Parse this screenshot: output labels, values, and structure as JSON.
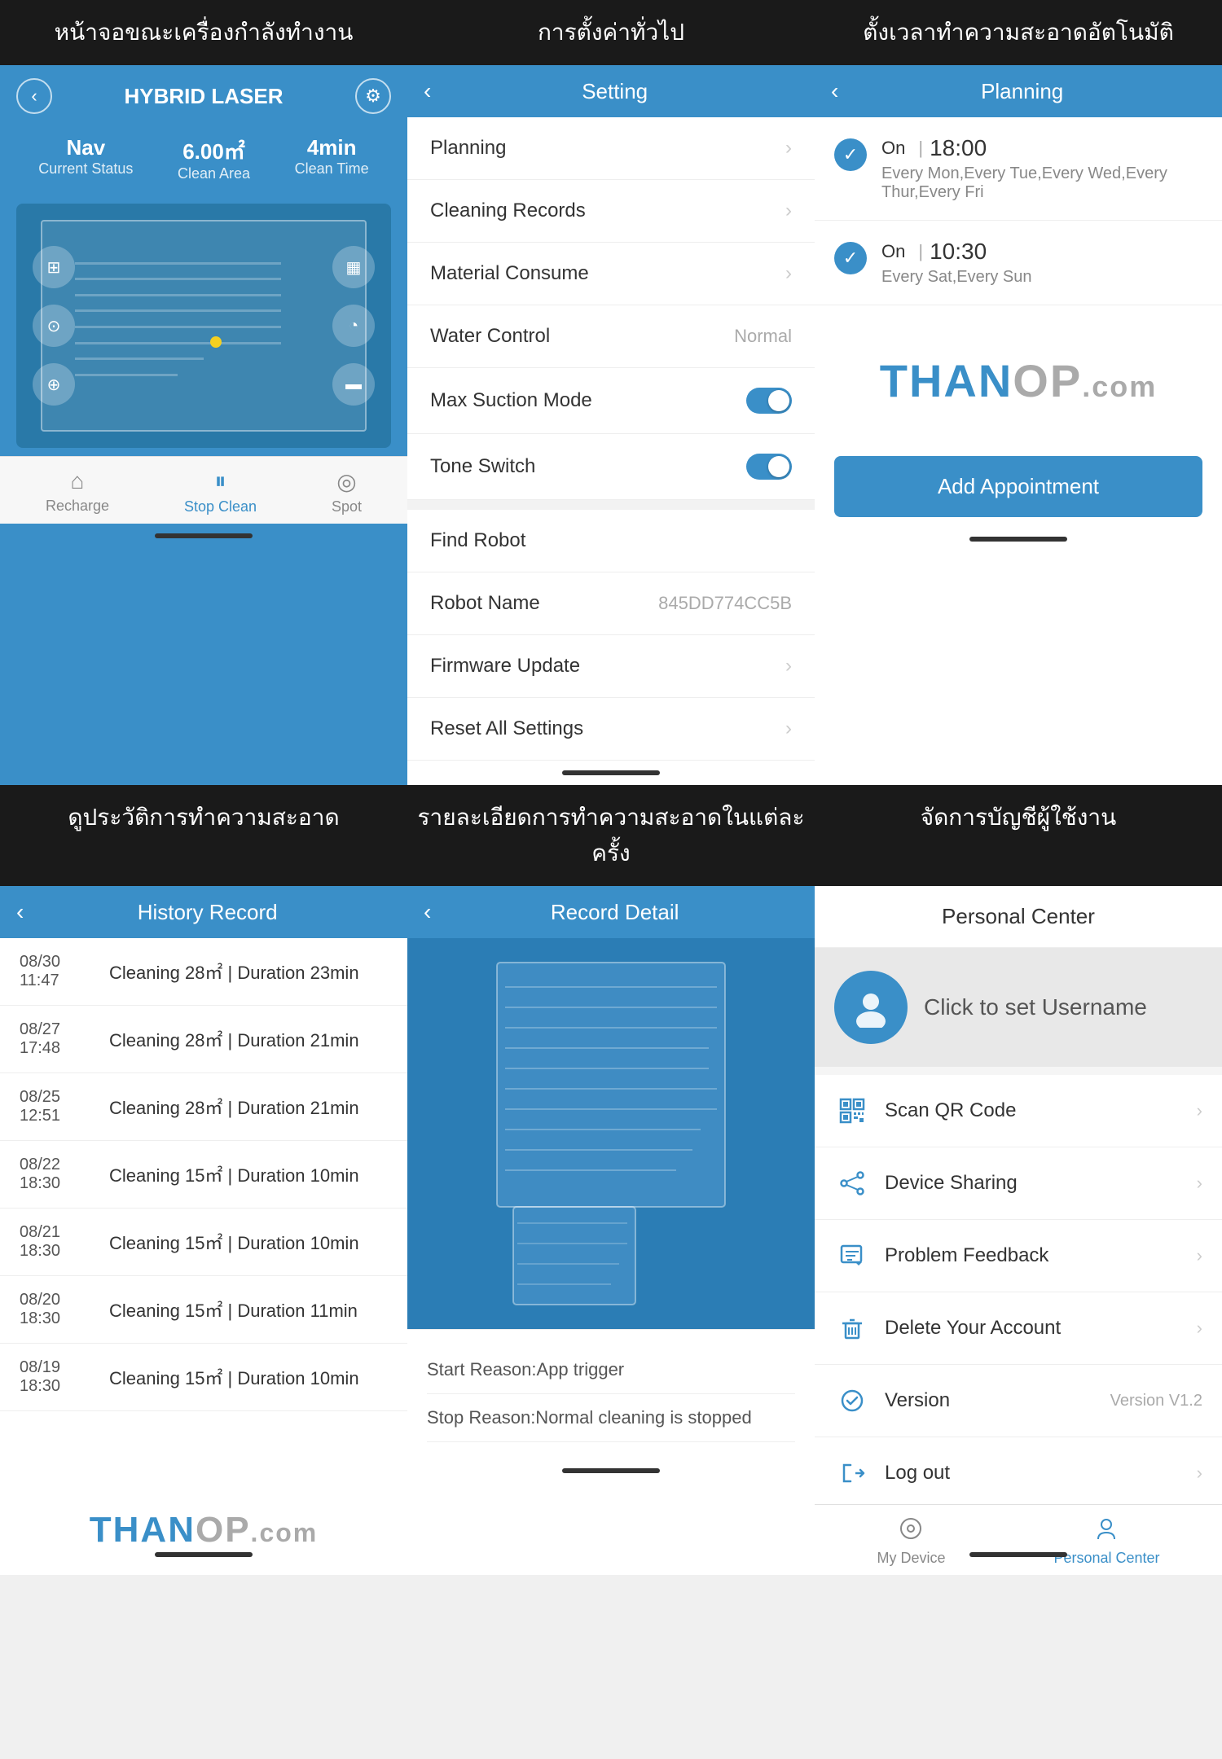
{
  "headers": {
    "col1_row1": "หน้าจอขณะเครื่องกำลังทำงาน",
    "col2_row1": "การตั้งค่าทั่วไป",
    "col3_row1": "ตั้งเวลาทำความสะอาดอัตโนมัติ",
    "col1_row2": "ดูประวัติการทำความสะอาด",
    "col2_row2": "รายละเอียดการทำความสะอาดในแต่ละครั้ง",
    "col3_row2": "จัดการบัญชีผู้ใช้งาน"
  },
  "panel1": {
    "title": "HYBRID LASER",
    "stats": [
      {
        "value": "Nav",
        "label": "Current Status"
      },
      {
        "value": "6.00㎡",
        "label": "Clean Area"
      },
      {
        "value": "4min",
        "label": "Clean Time"
      }
    ],
    "nav": [
      {
        "label": "Recharge",
        "active": false
      },
      {
        "label": "Stop Clean",
        "active": true
      },
      {
        "label": "Spot",
        "active": false
      }
    ]
  },
  "panel2": {
    "title": "Setting",
    "back_label": "‹",
    "items": [
      {
        "label": "Planning",
        "value": "",
        "type": "arrow"
      },
      {
        "label": "Cleaning Records",
        "value": "",
        "type": "arrow"
      },
      {
        "label": "Material Consume",
        "value": "",
        "type": "arrow"
      },
      {
        "label": "Water Control",
        "value": "Normal",
        "type": "value"
      },
      {
        "label": "Max Suction Mode",
        "value": "",
        "type": "toggle"
      },
      {
        "label": "Tone Switch",
        "value": "",
        "type": "toggle"
      },
      {
        "label": "Find Robot",
        "value": "",
        "type": "plain"
      },
      {
        "label": "Robot Name",
        "value": "845DD774CC5B",
        "type": "value"
      },
      {
        "label": "Firmware Update",
        "value": "",
        "type": "arrow"
      },
      {
        "label": "Reset All Settings",
        "value": "",
        "type": "arrow"
      }
    ]
  },
  "panel3": {
    "title": "Planning",
    "back_label": "‹",
    "schedules": [
      {
        "enabled": true,
        "status": "On",
        "time": "18:00",
        "days": "Every Mon,Every Tue,Every Wed,Every Thur,Every Fri"
      },
      {
        "enabled": true,
        "status": "On",
        "time": "10:30",
        "days": "Every Sat,Every Sun"
      }
    ],
    "add_button": "Add Appointment",
    "logo": "THANOP",
    "logo_ext": ".com"
  },
  "panel4": {
    "title": "History Record",
    "back_label": "‹",
    "records": [
      {
        "date": "08/30\n11:47",
        "desc": "Cleaning 28㎡ | Duration 23min"
      },
      {
        "date": "08/27\n17:48",
        "desc": "Cleaning 28㎡ | Duration 21min"
      },
      {
        "date": "08/25\n12:51",
        "desc": "Cleaning 28㎡ | Duration 21min"
      },
      {
        "date": "08/22\n18:30",
        "desc": "Cleaning 15㎡ | Duration 10min"
      },
      {
        "date": "08/21\n18:30",
        "desc": "Cleaning 15㎡ | Duration 10min"
      },
      {
        "date": "08/20\n18:30",
        "desc": "Cleaning 15㎡ | Duration 11min"
      },
      {
        "date": "08/19\n18:30",
        "desc": "Cleaning 15㎡ | Duration 10min"
      }
    ],
    "logo": "THANOP",
    "logo_ext": ".com"
  },
  "panel5": {
    "title": "Record Detail",
    "back_label": "‹",
    "start_reason": "Start Reason:App trigger",
    "stop_reason": "Stop Reason:Normal cleaning is stopped"
  },
  "panel6": {
    "title": "Personal Center",
    "username": "Click to set Username",
    "menu_items": [
      {
        "icon": "⬚",
        "label": "Scan QR Code",
        "value": "",
        "type": "arrow",
        "icon_name": "qr-code-icon"
      },
      {
        "icon": "⇄",
        "label": "Device Sharing",
        "value": "",
        "type": "arrow",
        "icon_name": "share-icon"
      },
      {
        "icon": "✎",
        "label": "Problem Feedback",
        "value": "",
        "type": "arrow",
        "icon_name": "feedback-icon"
      },
      {
        "icon": "🗑",
        "label": "Delete Your Account",
        "value": "",
        "type": "arrow",
        "icon_name": "delete-icon"
      },
      {
        "icon": "✓",
        "label": "Version",
        "value": "Version V1.2",
        "type": "value",
        "icon_name": "version-icon"
      },
      {
        "icon": "→",
        "label": "Log out",
        "value": "",
        "type": "arrow",
        "icon_name": "logout-icon"
      }
    ],
    "bottom_nav": [
      {
        "label": "My Device",
        "active": false,
        "icon_name": "my-device-nav-icon"
      },
      {
        "label": "Personal Center",
        "active": true,
        "icon_name": "personal-center-nav-icon"
      }
    ]
  }
}
